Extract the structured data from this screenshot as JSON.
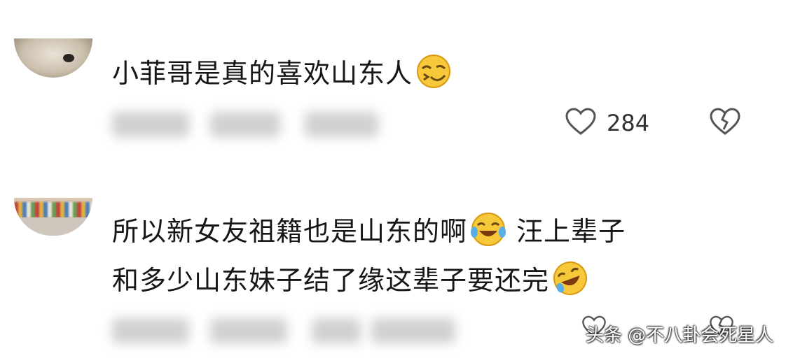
{
  "comments": [
    {
      "text": "小菲哥是真的喜欢山东人",
      "emoji": "grin-wink-emoji",
      "likes": "284"
    },
    {
      "line1": "所以新女友祖籍也是山东的啊",
      "emoji1": "tears-of-joy-emoji",
      "line1b": "汪上辈子",
      "line2": "和多少山东妹子结了缘这辈子要还完",
      "emoji2": "rofl-emoji"
    }
  ],
  "watermark": "头条 @不八卦会死星人",
  "colors": {
    "text": "#161616",
    "icon": "#555555",
    "background": "#ffffff"
  }
}
